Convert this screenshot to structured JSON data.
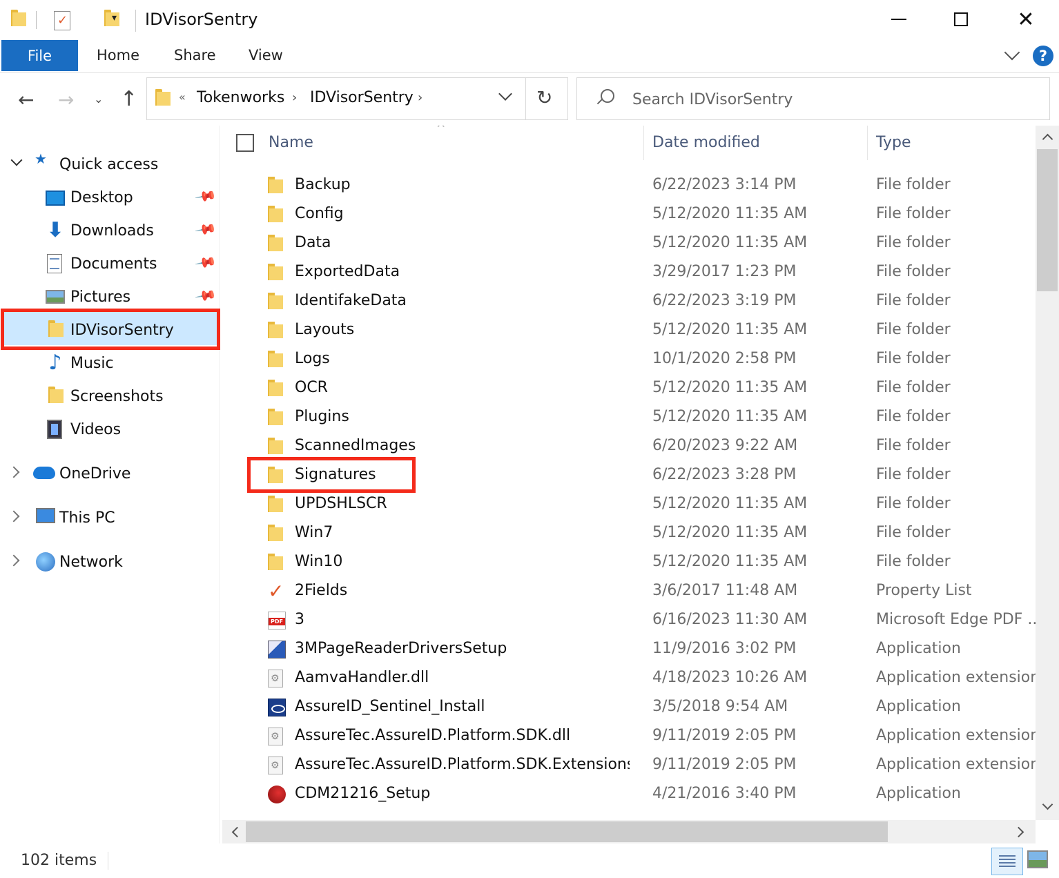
{
  "window": {
    "title": "IDVisorSentry",
    "qa_dropdown_glyph": "▾",
    "close_glyph": "✕"
  },
  "ribbon": {
    "tabs": [
      {
        "label": "File"
      },
      {
        "label": "Home"
      },
      {
        "label": "Share"
      },
      {
        "label": "View"
      }
    ],
    "help_label": "?"
  },
  "nav": {
    "back_glyph": "←",
    "forward_glyph": "→",
    "recent_glyph": "⌄",
    "up_glyph": "↑",
    "overflow_glyph": "«",
    "crumb_sep_glyph": "›",
    "refresh_glyph": "↻",
    "breadcrumb": [
      "Tokenworks",
      "IDVisorSentry"
    ]
  },
  "search": {
    "placeholder": "Search IDVisorSentry"
  },
  "sidebar": {
    "quick_access": "Quick access",
    "items": [
      {
        "label": "Desktop",
        "icon": "desktop-icon",
        "pinned": true
      },
      {
        "label": "Downloads",
        "icon": "downloads-icon",
        "pinned": true
      },
      {
        "label": "Documents",
        "icon": "documents-icon",
        "pinned": true
      },
      {
        "label": "Pictures",
        "icon": "pictures-icon",
        "pinned": true
      },
      {
        "label": "IDVisorSentry",
        "icon": "folder-icon",
        "pinned": false,
        "selected": true
      },
      {
        "label": "Music",
        "icon": "music-icon",
        "pinned": false
      },
      {
        "label": "Screenshots",
        "icon": "folder-icon",
        "pinned": false
      },
      {
        "label": "Videos",
        "icon": "videos-icon",
        "pinned": false
      }
    ],
    "roots": [
      {
        "label": "OneDrive",
        "icon": "onedrive-icon"
      },
      {
        "label": "This PC",
        "icon": "this-pc-icon"
      },
      {
        "label": "Network",
        "icon": "network-icon"
      }
    ],
    "pin_glyph": "📌",
    "star_glyph": "★",
    "down_glyph": "⬇",
    "music_glyph": "♪"
  },
  "filelist": {
    "sort_glyph": "^",
    "columns": {
      "name": "Name",
      "date": "Date modified",
      "type": "Type"
    },
    "rows": [
      {
        "name": "Backup",
        "date": "6/22/2023 3:14 PM",
        "type": "File folder",
        "icon": "folder"
      },
      {
        "name": "Config",
        "date": "5/12/2020 11:35 AM",
        "type": "File folder",
        "icon": "folder"
      },
      {
        "name": "Data",
        "date": "5/12/2020 11:35 AM",
        "type": "File folder",
        "icon": "folder"
      },
      {
        "name": "ExportedData",
        "date": "3/29/2017 1:23 PM",
        "type": "File folder",
        "icon": "folder"
      },
      {
        "name": "IdentifakeData",
        "date": "6/22/2023 3:19 PM",
        "type": "File folder",
        "icon": "folder"
      },
      {
        "name": "Layouts",
        "date": "5/12/2020 11:35 AM",
        "type": "File folder",
        "icon": "folder"
      },
      {
        "name": "Logs",
        "date": "10/1/2020 2:58 PM",
        "type": "File folder",
        "icon": "folder"
      },
      {
        "name": "OCR",
        "date": "5/12/2020 11:35 AM",
        "type": "File folder",
        "icon": "folder"
      },
      {
        "name": "Plugins",
        "date": "5/12/2020 11:35 AM",
        "type": "File folder",
        "icon": "folder"
      },
      {
        "name": "ScannedImages",
        "date": "6/20/2023 9:22 AM",
        "type": "File folder",
        "icon": "folder"
      },
      {
        "name": "Signatures",
        "date": "6/22/2023 3:28 PM",
        "type": "File folder",
        "icon": "folder"
      },
      {
        "name": "UPDSHLSCR",
        "date": "5/12/2020 11:35 AM",
        "type": "File folder",
        "icon": "folder"
      },
      {
        "name": "Win7",
        "date": "5/12/2020 11:35 AM",
        "type": "File folder",
        "icon": "folder"
      },
      {
        "name": "Win10",
        "date": "5/12/2020 11:35 AM",
        "type": "File folder",
        "icon": "folder"
      },
      {
        "name": "2Fields",
        "date": "3/6/2017 11:48 AM",
        "type": "Property List",
        "icon": "check"
      },
      {
        "name": "3",
        "date": "6/16/2023 11:30 AM",
        "type": "Microsoft Edge PDF ...",
        "icon": "pdf"
      },
      {
        "name": "3MPageReaderDriversSetup",
        "date": "11/9/2016 3:02 PM",
        "type": "Application",
        "icon": "setup"
      },
      {
        "name": "AamvaHandler.dll",
        "date": "4/18/2023 10:26 AM",
        "type": "Application extension",
        "icon": "dll"
      },
      {
        "name": "AssureID_Sentinel_Install",
        "date": "3/5/2018 9:54 AM",
        "type": "Application",
        "icon": "assure"
      },
      {
        "name": "AssureTec.AssureID.Platform.SDK.dll",
        "date": "9/11/2019 2:05 PM",
        "type": "Application extension",
        "icon": "dll"
      },
      {
        "name": "AssureTec.AssureID.Platform.SDK.Extensions....",
        "date": "9/11/2019 2:05 PM",
        "type": "Application extension",
        "icon": "dll"
      },
      {
        "name": "CDM21216_Setup",
        "date": "4/21/2016 3:40 PM",
        "type": "Application",
        "icon": "cdm"
      }
    ],
    "pdf_badge": "PDF"
  },
  "status": {
    "item_count": "102 items"
  },
  "colors": {
    "accent": "#1a6dc2",
    "selection": "#cce8ff",
    "annotation": "#f42a1a"
  }
}
